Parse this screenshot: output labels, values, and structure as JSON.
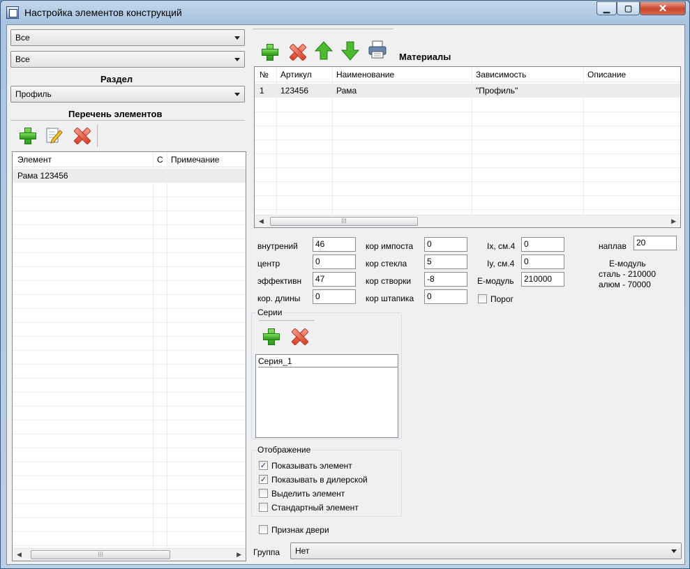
{
  "window": {
    "title": "Настройка элементов конструкций"
  },
  "left": {
    "filter1": "Все",
    "filter2": "Все",
    "section_label": "Раздел",
    "section_value": "Профиль",
    "list_title": "Перечень элементов",
    "columns": [
      "Элемент",
      "С",
      "Примечание"
    ],
    "rows": [
      {
        "element": "Рама 123456",
        "c": "",
        "note": ""
      }
    ]
  },
  "materials": {
    "title": "Материалы",
    "columns": [
      "№",
      "Артикул",
      "Наименование",
      "Зависимость",
      "Описание"
    ],
    "rows": [
      {
        "num": "1",
        "article": "123456",
        "name": "Рама",
        "dependency": "\"Профиль\"",
        "description": ""
      }
    ]
  },
  "params": {
    "vnutreniy": {
      "label": "внутрений",
      "value": "46"
    },
    "centr": {
      "label": "центр",
      "value": "0"
    },
    "effektivn": {
      "label": "эффективн",
      "value": "47"
    },
    "kor_dliny": {
      "label": "кор. длины",
      "value": "0"
    },
    "kor_imposta": {
      "label": "кор импоста",
      "value": "0"
    },
    "kor_stekla": {
      "label": "кор стекла",
      "value": "5"
    },
    "kor_stvorki": {
      "label": "кор створки",
      "value": "-8"
    },
    "kor_shtapika": {
      "label": "кор штапика",
      "value": "0"
    },
    "ix": {
      "label": "Ix, см.4",
      "value": "0"
    },
    "iy": {
      "label": "Iy, см.4",
      "value": "0"
    },
    "e_modul": {
      "label": "E-модуль",
      "value": "210000"
    },
    "porog": {
      "label": "Порог",
      "checked": false
    },
    "naplav": {
      "label": "наплав",
      "value": "20"
    },
    "e_note1": "E-модуль",
    "e_note2": "сталь - 210000",
    "e_note3": "алюм - 70000"
  },
  "series": {
    "title": "Серии",
    "items": [
      "Серия_1"
    ]
  },
  "display": {
    "title": "Отображение",
    "options": [
      {
        "label": "Показывать элемент",
        "checked": true
      },
      {
        "label": "Показывать в дилерской",
        "checked": true
      },
      {
        "label": "Выделить элемент",
        "checked": false
      },
      {
        "label": "Стандартный элемент",
        "checked": false
      }
    ]
  },
  "door": {
    "label": "Признак двери",
    "checked": false
  },
  "group": {
    "label": "Группа",
    "value": "Нет"
  },
  "icons": [
    "app-icon",
    "add-icon",
    "edit-icon",
    "delete-icon",
    "move-up-icon",
    "move-down-icon",
    "print-icon"
  ]
}
